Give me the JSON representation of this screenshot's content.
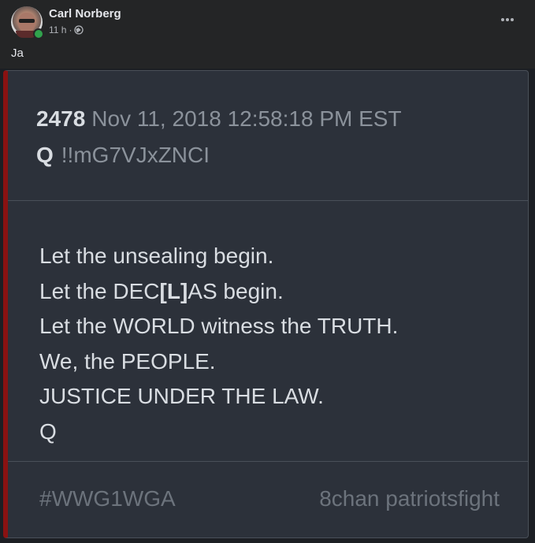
{
  "post": {
    "author": "Carl Norberg",
    "time": "11 h",
    "separator": "·",
    "privacy_icon": "globe-icon",
    "text": "Ja",
    "more_icon": "more-options-icon"
  },
  "image": {
    "post_number": "2478",
    "date": "Nov 11, 2018 12:58:18 PM EST",
    "poster_name": "Q",
    "tripcode": "!!mG7VJxZNCI",
    "lines": {
      "l1": "Let the unsealing begin.",
      "l2_pre": "Let the DEC",
      "l2_bracket": "[L]",
      "l2_post": "AS begin.",
      "l3": "Let the WORLD witness the TRUTH.",
      "l4": "We, the PEOPLE.",
      "l5": "JUSTICE UNDER THE LAW.",
      "l6": "Q"
    },
    "hashtag": "#WWG1WGA",
    "source": "8chan patriotsfight"
  },
  "colors": {
    "background": "#242526",
    "online": "#31a24c",
    "card_accent": "#8a1212"
  }
}
